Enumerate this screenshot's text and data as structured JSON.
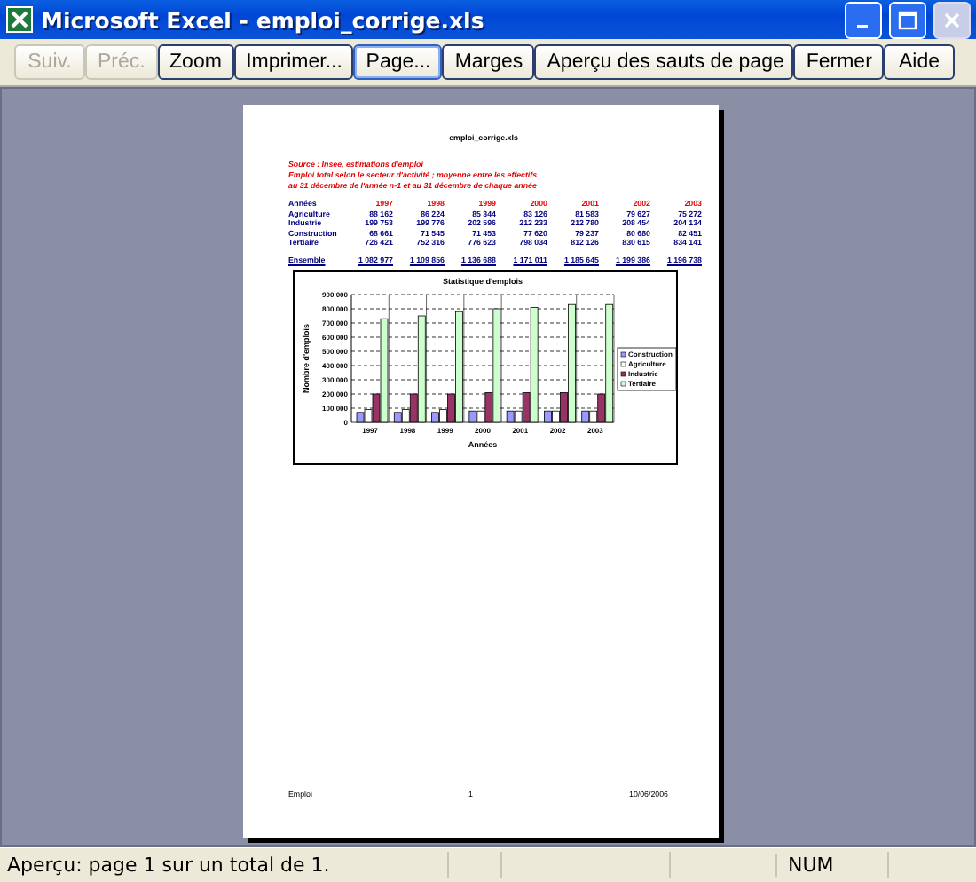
{
  "window": {
    "title": "Microsoft Excel - emploi_corrige.xls"
  },
  "toolbar": [
    {
      "label": "Suiv.",
      "disabled": true,
      "selected": false
    },
    {
      "label": "Préc.",
      "disabled": true,
      "selected": false
    },
    {
      "label": "Zoom",
      "disabled": false,
      "selected": false
    },
    {
      "label": "Imprimer...",
      "disabled": false,
      "selected": false
    },
    {
      "label": "Page...",
      "disabled": false,
      "selected": true
    },
    {
      "label": "Marges",
      "disabled": false,
      "selected": false
    },
    {
      "label": "Aperçu des sauts de page",
      "disabled": false,
      "selected": false
    },
    {
      "label": "Fermer",
      "disabled": false,
      "selected": false
    },
    {
      "label": "Aide",
      "disabled": false,
      "selected": false
    }
  ],
  "page": {
    "header": "emploi_corrige.xls",
    "notes": [
      "Source : Insee, estimations d'emploi",
      "Emploi total selon le secteur d'activité ; moyenne entre les effectifs",
      "au 31 décembre de l'année n-1 et au 31 décembre de chaque année"
    ],
    "table": {
      "columns": [
        "Années",
        "1997",
        "1998",
        "1999",
        "2000",
        "2001",
        "2002",
        "2003"
      ],
      "rows": [
        [
          "Agriculture",
          "88 162",
          "86 224",
          "85 344",
          "83 126",
          "81 583",
          "79 627",
          "75 272"
        ],
        [
          "Industrie",
          "199 753",
          "199 776",
          "202 596",
          "212 233",
          "212 780",
          "208 454",
          "204 134"
        ],
        [
          "Construction",
          "68 661",
          "71 545",
          "71 453",
          "77 620",
          "79 237",
          "80 680",
          "82 451"
        ],
        [
          "Tertiaire",
          "726 421",
          "752 316",
          "776 623",
          "798 034",
          "812 126",
          "830 615",
          "834 141"
        ]
      ],
      "total": [
        "Ensemble",
        "1 082 977",
        "1 109 856",
        "1 136 688",
        "1 171 011",
        "1 185 645",
        "1 199 386",
        "1 196 738"
      ]
    },
    "chart_data": {
      "type": "bar",
      "title": "Statistique d'emplois",
      "xlabel": "Années",
      "ylabel": "Nombre d'emplois",
      "categories": [
        "1997",
        "1998",
        "1999",
        "2000",
        "2001",
        "2002",
        "2003"
      ],
      "series": [
        {
          "name": "Construction",
          "color": "#9999ff",
          "values": [
            70000,
            70000,
            70000,
            80000,
            80000,
            80000,
            80000
          ]
        },
        {
          "name": "Agriculture",
          "color": "#ffffff",
          "values": [
            90000,
            90000,
            90000,
            80000,
            80000,
            80000,
            80000
          ]
        },
        {
          "name": "Industrie",
          "color": "#993366",
          "values": [
            200000,
            200000,
            200000,
            210000,
            210000,
            210000,
            200000
          ]
        },
        {
          "name": "Tertiaire",
          "color": "#ccffcc",
          "values": [
            730000,
            750000,
            780000,
            800000,
            810000,
            830000,
            830000
          ]
        }
      ],
      "ylim": [
        0,
        900000
      ],
      "grid": true,
      "legend": "right",
      "yticks": [
        {
          "value": 0,
          "label": "0"
        },
        {
          "value": 100000,
          "label": "100 000"
        },
        {
          "value": 200000,
          "label": "200 000"
        },
        {
          "value": 300000,
          "label": "300 000"
        },
        {
          "value": 400000,
          "label": "400 000"
        },
        {
          "value": 500000,
          "label": "500 000"
        },
        {
          "value": 600000,
          "label": "600 000"
        },
        {
          "value": 700000,
          "label": "700 000"
        },
        {
          "value": 800000,
          "label": "800 000"
        },
        {
          "value": 900000,
          "label": "900 000"
        }
      ]
    },
    "footer": [
      "Emploi",
      "1",
      "10/06/2006"
    ]
  },
  "status_bar": {
    "message": "Aperçu: page 1 sur un total de 1.",
    "indicator": "NUM"
  }
}
